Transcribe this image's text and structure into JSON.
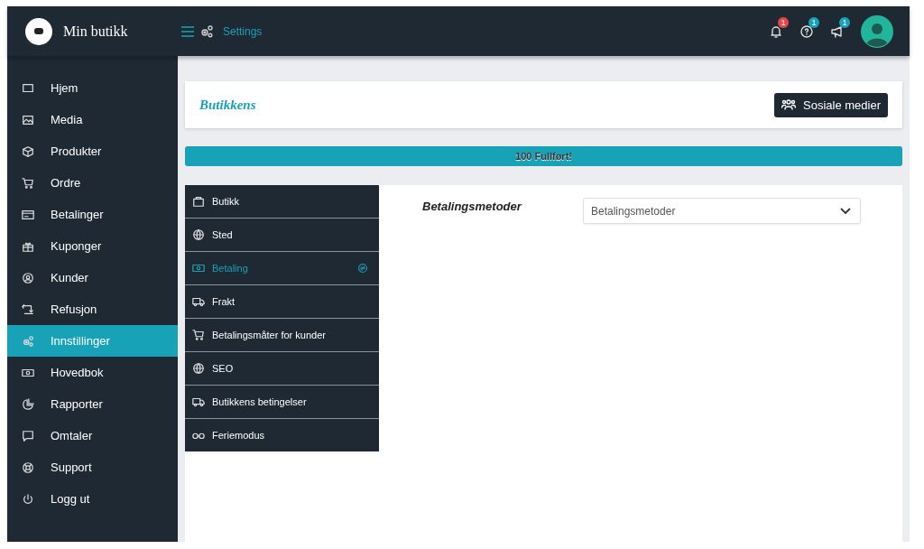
{
  "header": {
    "brand": "Min butikk",
    "breadcrumb": "Settings",
    "notifications": [
      {
        "kind": "bell",
        "badge": "1",
        "color": "#e8454c"
      },
      {
        "kind": "help",
        "badge": "1",
        "color": "#17a2b8"
      },
      {
        "kind": "megaphone",
        "badge": "1",
        "color": "#17a2b8"
      }
    ]
  },
  "sidebar": {
    "items": [
      {
        "label": "Hjem",
        "selected": false
      },
      {
        "label": "Media",
        "selected": false
      },
      {
        "label": "Produkter",
        "selected": false
      },
      {
        "label": "Ordre",
        "selected": false
      },
      {
        "label": "Betalinger",
        "selected": false
      },
      {
        "label": "Kuponger",
        "selected": false
      },
      {
        "label": "Kunder",
        "selected": false
      },
      {
        "label": "Refusjon",
        "selected": false
      },
      {
        "label": "Innstillinger",
        "selected": true
      },
      {
        "label": "Hovedbok",
        "selected": false
      },
      {
        "label": "Rapporter",
        "selected": false
      },
      {
        "label": "Omtaler",
        "selected": false
      },
      {
        "label": "Support",
        "selected": false
      },
      {
        "label": "Logg ut",
        "selected": false
      }
    ]
  },
  "card": {
    "title": "Butikkens",
    "button": "Sosiale medier"
  },
  "progress": {
    "level": 1,
    "label": "100 Fullført!"
  },
  "settings_menu": [
    {
      "label": "Butikk",
      "selected": false
    },
    {
      "label": "Sted",
      "selected": false
    },
    {
      "label": "Betaling",
      "selected": true
    },
    {
      "label": "Frakt",
      "selected": false
    },
    {
      "label": "Betalingsmåter for kunder",
      "selected": false
    },
    {
      "label": "SEO",
      "selected": false
    },
    {
      "label": "Butikkens betingelser",
      "selected": false
    },
    {
      "label": "Feriemodus",
      "selected": false
    }
  ],
  "form": {
    "label": "Betalingsmetoder",
    "select_value": "Betalingsmetoder"
  }
}
